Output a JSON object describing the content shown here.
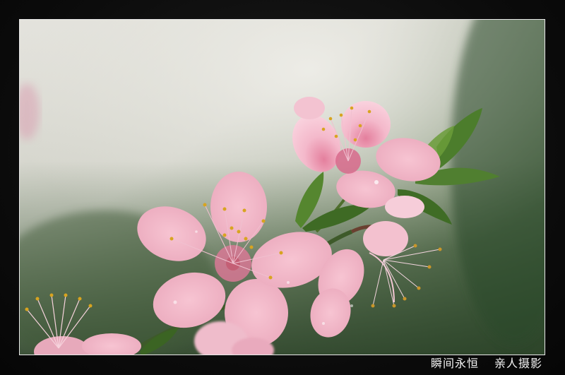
{
  "image": {
    "subject": "peach-blossom-branch",
    "colors": {
      "frame": "#0b0b0b",
      "border": "#e8e8e8",
      "background_light": "#d8d8d0",
      "background_green": "#3d5638",
      "petal": "#f2b8c8",
      "petal_deep": "#e68aa5",
      "leaf": "#4b7b2e",
      "stamen": "#d8a420"
    }
  },
  "caption": {
    "part1": "瞬间永恒",
    "part2": "亲人摄影"
  }
}
